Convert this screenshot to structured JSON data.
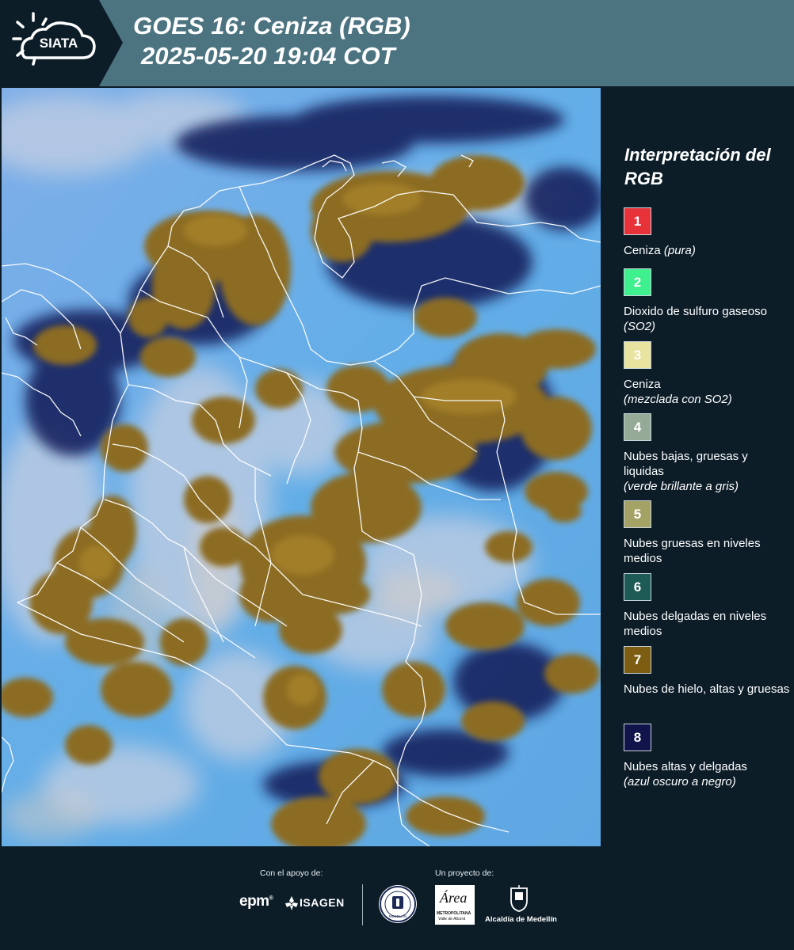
{
  "header": {
    "logo_text": "SIATA",
    "title_line1": "GOES 16: Ceniza (RGB)",
    "title_line2": "2025-05-20 19:04 COT"
  },
  "legend": {
    "title": "Interpretación del RGB",
    "items": [
      {
        "num": "1",
        "color": "#e8323a",
        "label": "Ceniza ",
        "sub": "(pura)"
      },
      {
        "num": "2",
        "color": "#3ff08e",
        "label": "Dioxido de sulfuro gaseoso ",
        "sub": "(SO2)"
      },
      {
        "num": "3",
        "color": "#e9e3a0",
        "label": "Ceniza",
        "sub": "(mezclada con SO2)"
      },
      {
        "num": "4",
        "color": "#95ab97",
        "label": "Nubes bajas, gruesas y liquidas",
        "sub": "(verde brillante a gris)"
      },
      {
        "num": "5",
        "color": "#a5a266",
        "label": "Nubes gruesas en niveles medios",
        "sub": ""
      },
      {
        "num": "6",
        "color": "#1e5a56",
        "label": "Nubes delgadas en niveles medios",
        "sub": ""
      },
      {
        "num": "7",
        "color": "#7d5d12",
        "label": "Nubes de hielo, altas y gruesas",
        "sub": ""
      },
      {
        "num": "8",
        "color": "#10144a",
        "label": "Nubes altas y delgadas",
        "sub": "(azul oscuro a negro)"
      }
    ]
  },
  "footer": {
    "support_label": "Con el apoyo de:",
    "project_label": "Un proyecto de:",
    "epm": "epm",
    "isagen": "ISAGEN",
    "area_name": "Área",
    "area_sub": "METROPOLITANA",
    "area_sub2": "Valle de Aburrá",
    "alcaldia": "Alcaldía de Medellín",
    "medellin_seal": "MEDELLÍN"
  },
  "colors": {
    "header_bg": "#4b7380",
    "panel_bg": "#0c1d28",
    "map_sky": "#6fb0ea",
    "cloud_ice": "#8e6e22",
    "thin_high": "#101a55"
  }
}
